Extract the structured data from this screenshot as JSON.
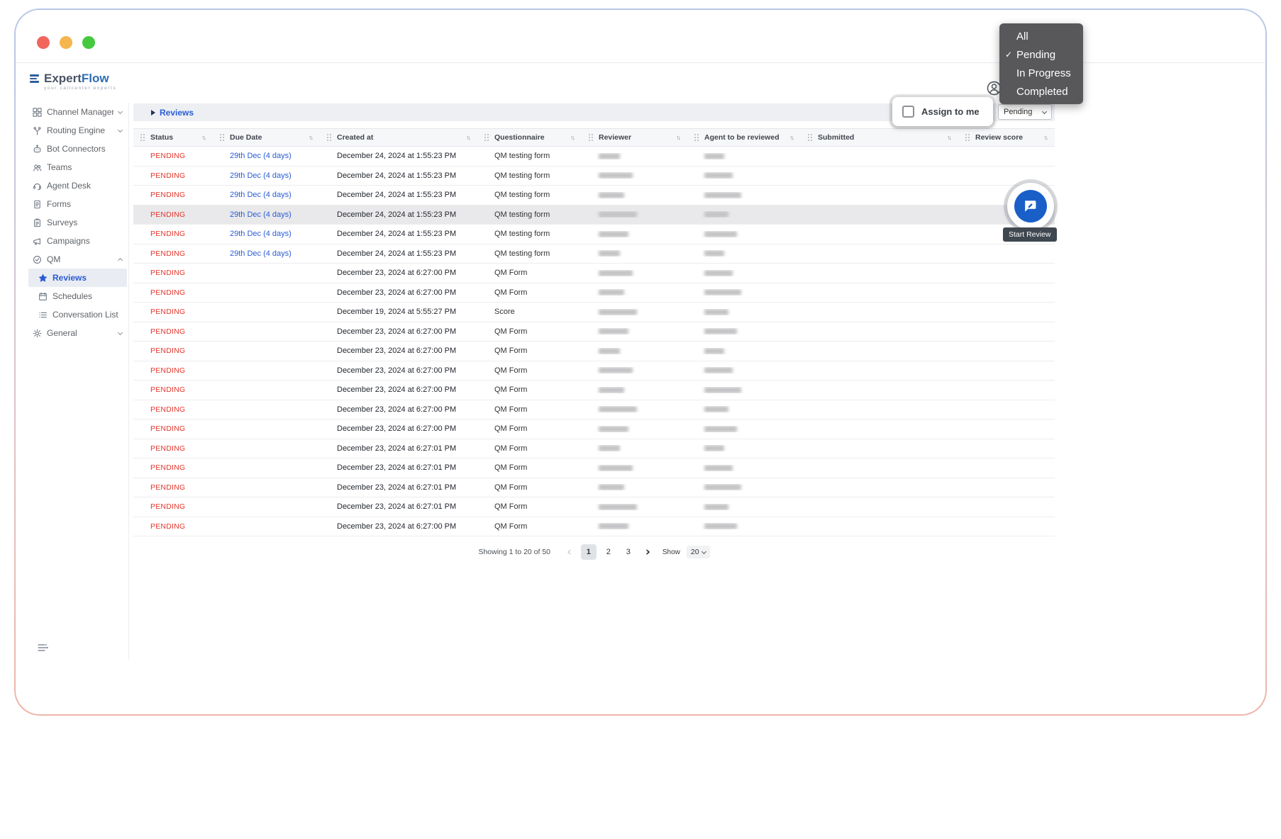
{
  "brand": {
    "name_primary": "Expert",
    "name_secondary": "Flow",
    "tagline": "your callcenter experts"
  },
  "sidebar": {
    "items": [
      {
        "label": "Channel Manager",
        "icon": "grid-icon",
        "chevron": "down"
      },
      {
        "label": "Routing Engine",
        "icon": "routing-icon",
        "chevron": "down"
      },
      {
        "label": "Bot Connectors",
        "icon": "bot-icon"
      },
      {
        "label": "Teams",
        "icon": "teams-icon"
      },
      {
        "label": "Agent Desk",
        "icon": "agent-desk-icon"
      },
      {
        "label": "Forms",
        "icon": "forms-icon"
      },
      {
        "label": "Surveys",
        "icon": "surveys-icon"
      },
      {
        "label": "Campaigns",
        "icon": "campaigns-icon"
      },
      {
        "label": "QM",
        "icon": "qm-icon",
        "chevron": "up"
      },
      {
        "label": "Reviews",
        "icon": "star-icon",
        "child": true,
        "selected": true
      },
      {
        "label": "Schedules",
        "icon": "calendar-icon",
        "child": true
      },
      {
        "label": "Conversation List",
        "icon": "list-icon",
        "child": true
      },
      {
        "label": "General",
        "icon": "gear-icon",
        "chevron": "down"
      }
    ]
  },
  "topbar": {
    "breadcrumb": "Reviews"
  },
  "filters": {
    "assign_to_me_label": "Assign to me",
    "assign_checked": false,
    "status_value": "Pending"
  },
  "status_menu": {
    "options": [
      {
        "label": "All",
        "checked": false
      },
      {
        "label": "Pending",
        "checked": true
      },
      {
        "label": "In Progress",
        "checked": false
      },
      {
        "label": "Completed",
        "checked": false
      }
    ]
  },
  "table": {
    "columns": [
      "Status",
      "Due Date",
      "Created at",
      "Questionnaire",
      "Reviewer",
      "Agent to be reviewed",
      "Submitted",
      "Review score"
    ],
    "redacted_columns": [
      "Reviewer",
      "Agent to be reviewed"
    ],
    "rows": [
      {
        "status": "PENDING",
        "due": "29th Dec (4 days)",
        "created": "December 24, 2024 at 1:55:23 PM",
        "questionnaire": "QM testing form"
      },
      {
        "status": "PENDING",
        "due": "29th Dec (4 days)",
        "created": "December 24, 2024 at 1:55:23 PM",
        "questionnaire": "QM testing form"
      },
      {
        "status": "PENDING",
        "due": "29th Dec (4 days)",
        "created": "December 24, 2024 at 1:55:23 PM",
        "questionnaire": "QM testing form"
      },
      {
        "status": "PENDING",
        "due": "29th Dec (4 days)",
        "created": "December 24, 2024 at 1:55:23 PM",
        "questionnaire": "QM testing form",
        "highlighted": true
      },
      {
        "status": "PENDING",
        "due": "29th Dec (4 days)",
        "created": "December 24, 2024 at 1:55:23 PM",
        "questionnaire": "QM testing form"
      },
      {
        "status": "PENDING",
        "due": "29th Dec (4 days)",
        "created": "December 24, 2024 at 1:55:23 PM",
        "questionnaire": "QM testing form"
      },
      {
        "status": "PENDING",
        "due": "",
        "created": "December 23, 2024 at 6:27:00 PM",
        "questionnaire": "QM Form"
      },
      {
        "status": "PENDING",
        "due": "",
        "created": "December 23, 2024 at 6:27:00 PM",
        "questionnaire": "QM Form"
      },
      {
        "status": "PENDING",
        "due": "",
        "created": "December 19, 2024 at 5:55:27 PM",
        "questionnaire": "Score"
      },
      {
        "status": "PENDING",
        "due": "",
        "created": "December 23, 2024 at 6:27:00 PM",
        "questionnaire": "QM Form"
      },
      {
        "status": "PENDING",
        "due": "",
        "created": "December 23, 2024 at 6:27:00 PM",
        "questionnaire": "QM Form"
      },
      {
        "status": "PENDING",
        "due": "",
        "created": "December 23, 2024 at 6:27:00 PM",
        "questionnaire": "QM Form"
      },
      {
        "status": "PENDING",
        "due": "",
        "created": "December 23, 2024 at 6:27:00 PM",
        "questionnaire": "QM Form"
      },
      {
        "status": "PENDING",
        "due": "",
        "created": "December 23, 2024 at 6:27:00 PM",
        "questionnaire": "QM Form"
      },
      {
        "status": "PENDING",
        "due": "",
        "created": "December 23, 2024 at 6:27:00 PM",
        "questionnaire": "QM Form"
      },
      {
        "status": "PENDING",
        "due": "",
        "created": "December 23, 2024 at 6:27:01 PM",
        "questionnaire": "QM Form"
      },
      {
        "status": "PENDING",
        "due": "",
        "created": "December 23, 2024 at 6:27:01 PM",
        "questionnaire": "QM Form"
      },
      {
        "status": "PENDING",
        "due": "",
        "created": "December 23, 2024 at 6:27:01 PM",
        "questionnaire": "QM Form"
      },
      {
        "status": "PENDING",
        "due": "",
        "created": "December 23, 2024 at 6:27:01 PM",
        "questionnaire": "QM Form"
      },
      {
        "status": "PENDING",
        "due": "",
        "created": "December 23, 2024 at 6:27:00 PM",
        "questionnaire": "QM Form"
      }
    ]
  },
  "pagination": {
    "summary": "Showing 1 to 20 of 50",
    "pages": [
      "1",
      "2",
      "3"
    ],
    "active": "1",
    "show_label": "Show",
    "page_size": "20"
  },
  "tour": {
    "start_review_tooltip": "Start Review"
  },
  "colors": {
    "accent_blue": "#2a5cd5",
    "pending_red": "#e5352b",
    "fab_blue": "#1a5fc8",
    "menu_bg": "#58585b"
  }
}
